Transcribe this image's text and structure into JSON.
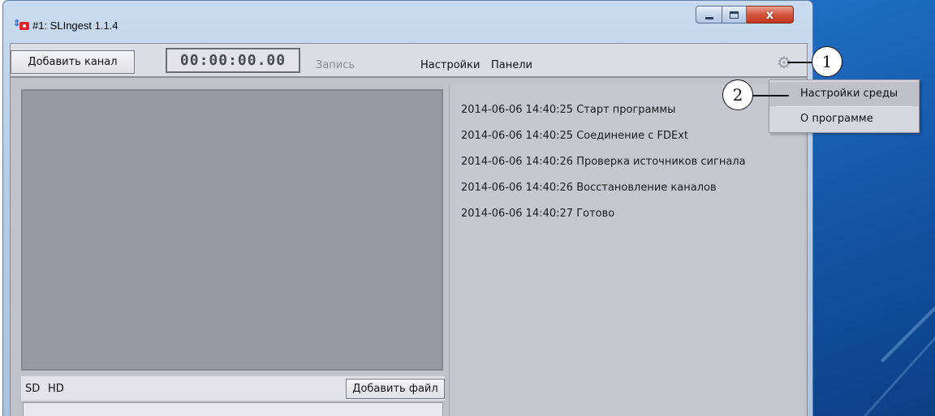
{
  "window": {
    "title": "#1: SLIngest 1.1.4",
    "close_glyph": "x"
  },
  "toolbar": {
    "add_channel_label": "Добавить канал",
    "timecode": "00:00:00.00",
    "record_label": "Запись",
    "settings_label": "Настройки",
    "panels_label": "Панели",
    "gear_icon": "gear-icon"
  },
  "source_panel": {
    "tab_sd": "SD",
    "tab_hd": "HD",
    "add_file_label": "Добавить файл"
  },
  "log": {
    "lines": [
      "2014-06-06 14:40:25  Старт программы",
      "2014-06-06 14:40:25  Соединение с FDExt",
      "2014-06-06 14:40:26  Проверка источников сигнала",
      "2014-06-06 14:40:26  Восстановление каналов",
      "2014-06-06 14:40:27  Готово"
    ]
  },
  "menu": {
    "items": [
      {
        "label": "Настройки среды",
        "highlighted": true
      },
      {
        "label": "О программе",
        "highlighted": false
      }
    ]
  },
  "callouts": {
    "one": "1",
    "two": "2"
  },
  "colors": {
    "close_button": "#c1371f",
    "preview_background": "#9999a3",
    "log_background": "#c6c6ce",
    "desktop_blue": "#1458a8"
  }
}
